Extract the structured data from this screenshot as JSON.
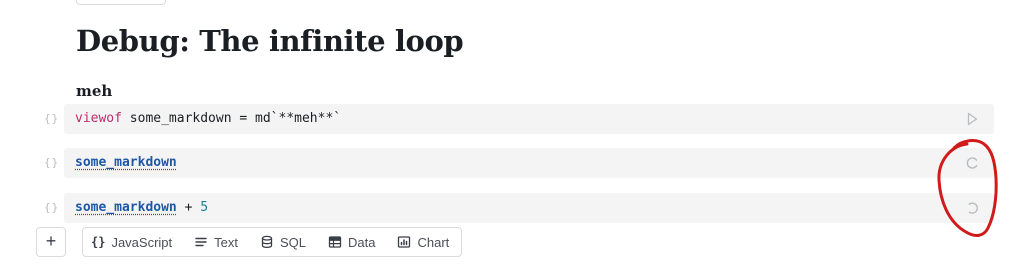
{
  "page": {
    "title": "Debug: The infinite loop"
  },
  "cells": [
    {
      "output": "meh",
      "gutter": "{}",
      "code": {
        "keyword": "viewof",
        "text": " some_markdown = md`**meh**`"
      },
      "status_icon": "run-play-icon"
    },
    {
      "gutter": "{}",
      "code": {
        "ref": "some_markdown"
      },
      "status_icon": "loading-spinner-icon"
    },
    {
      "gutter": "{}",
      "code": {
        "ref": "some_markdown",
        "op": " + ",
        "number": "5"
      },
      "status_icon": "loading-spinner-icon"
    }
  ],
  "toolbar": {
    "add_label": "+",
    "types": [
      {
        "label": "JavaScript",
        "icon": "braces-icon"
      },
      {
        "label": "Text",
        "icon": "text-lines-icon"
      },
      {
        "label": "SQL",
        "icon": "database-icon"
      },
      {
        "label": "Data",
        "icon": "table-icon"
      },
      {
        "label": "Chart",
        "icon": "chart-icon"
      }
    ]
  },
  "colors": {
    "keyword": "#c6286e",
    "reference": "#1f57a5",
    "number": "#157f97",
    "annotation_circle": "#d11a1a"
  }
}
